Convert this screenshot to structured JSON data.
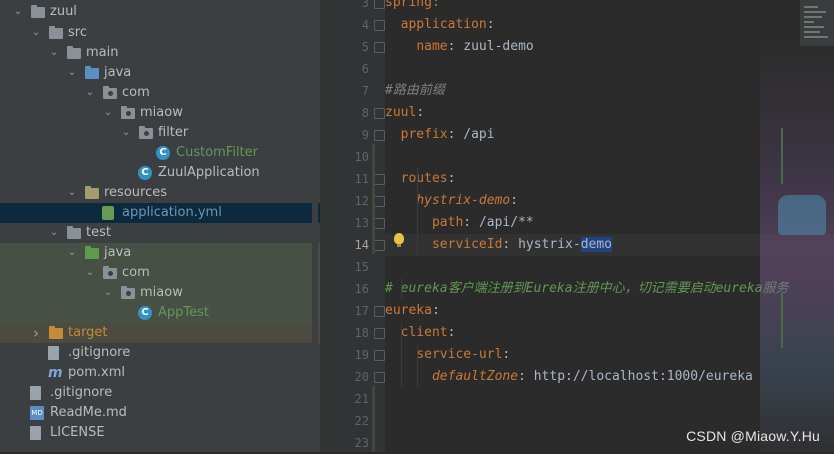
{
  "project_tree": {
    "items": [
      {
        "label": "zuul",
        "icon": "module-folder-icon",
        "expanded": true,
        "color": "#bbbbbb"
      },
      {
        "label": "src",
        "icon": "folder-icon",
        "expanded": true,
        "color": "#bbbbbb"
      },
      {
        "label": "main",
        "icon": "folder-icon",
        "expanded": true,
        "color": "#bbbbbb"
      },
      {
        "label": "java",
        "icon": "source-root-folder-icon",
        "expanded": true,
        "color": "#bbbbbb"
      },
      {
        "label": "com",
        "icon": "package-icon",
        "expanded": true,
        "color": "#bbbbbb"
      },
      {
        "label": "miaow",
        "icon": "package-icon",
        "expanded": true,
        "color": "#bbbbbb"
      },
      {
        "label": "filter",
        "icon": "package-icon",
        "expanded": true,
        "color": "#bbbbbb"
      },
      {
        "label": "CustomFilter",
        "icon": "java-class-icon",
        "color": "#629755"
      },
      {
        "label": "ZuulApplication",
        "icon": "spring-boot-class-icon",
        "color": "#bbbbbb"
      },
      {
        "label": "resources",
        "icon": "resources-folder-icon",
        "expanded": true,
        "color": "#bbbbbb"
      },
      {
        "label": "application.yml",
        "icon": "yaml-file-icon",
        "color": "#6897bb",
        "selected": true
      },
      {
        "label": "test",
        "icon": "folder-icon",
        "expanded": true,
        "color": "#bbbbbb"
      },
      {
        "label": "java",
        "icon": "test-root-folder-icon",
        "expanded": true,
        "color": "#bbbbbb"
      },
      {
        "label": "com",
        "icon": "package-icon",
        "expanded": true,
        "color": "#bbbbbb"
      },
      {
        "label": "miaow",
        "icon": "package-icon",
        "expanded": true,
        "color": "#bbbbbb"
      },
      {
        "label": "AppTest",
        "icon": "java-class-icon",
        "color": "#629755"
      },
      {
        "label": "target",
        "icon": "excluded-folder-icon",
        "expanded": false,
        "color": "#c48b39"
      },
      {
        "label": ".gitignore",
        "icon": "gitignore-file-icon",
        "color": "#bbbbbb"
      },
      {
        "label": "pom.xml",
        "icon": "maven-icon",
        "color": "#bbbbbb"
      },
      {
        "label": ".gitignore",
        "icon": "gitignore-file-icon",
        "color": "#bbbbbb"
      },
      {
        "label": "ReadMe.md",
        "icon": "markdown-file-icon",
        "color": "#bbbbbb"
      },
      {
        "label": "LICENSE",
        "icon": "text-file-icon",
        "color": "#bbbbbb"
      }
    ]
  },
  "editor": {
    "lines": [
      {
        "n": "3",
        "text": "spring:"
      },
      {
        "n": "4",
        "key": "application",
        "text": ":"
      },
      {
        "n": "5",
        "key": "name",
        "sep": ": ",
        "val": "zuul-demo"
      },
      {
        "n": "6"
      },
      {
        "n": "7",
        "comment": "#路由前缀"
      },
      {
        "n": "8",
        "key": "zuul",
        "text": ":"
      },
      {
        "n": "9",
        "key": "prefix",
        "sep": ": ",
        "val": "/api"
      },
      {
        "n": "10"
      },
      {
        "n": "11",
        "key": "routes",
        "text": ":"
      },
      {
        "n": "12",
        "key": "hystrix-demo",
        "text": ":"
      },
      {
        "n": "13",
        "key": "path",
        "sep": ": ",
        "val": "/api/**"
      },
      {
        "n": "14",
        "key": "serviceId",
        "sep": ": ",
        "val": "hystrix-",
        "val_hl": "demo"
      },
      {
        "n": "15"
      },
      {
        "n": "16",
        "comment": "# eureka客户端注册到Eureka注册中心，切记需要启动eureka服务"
      },
      {
        "n": "17",
        "key": "eureka",
        "text": ":"
      },
      {
        "n": "18",
        "key": "client",
        "text": ":"
      },
      {
        "n": "19",
        "key": "service-url",
        "text": ":"
      },
      {
        "n": "20",
        "key": "defaultZone",
        "sep": ": ",
        "val": "http://localhost:1000/eureka"
      },
      {
        "n": "21"
      },
      {
        "n": "22"
      },
      {
        "n": "23"
      }
    ],
    "active_line": "14"
  },
  "colors": {
    "keyword": "#cc7832",
    "value": "#a9b7c6",
    "comment": "#808080",
    "line_number": "#606366",
    "selected_row": "#0d293e"
  },
  "watermark": "CSDN @Miaow.Y.Hu"
}
